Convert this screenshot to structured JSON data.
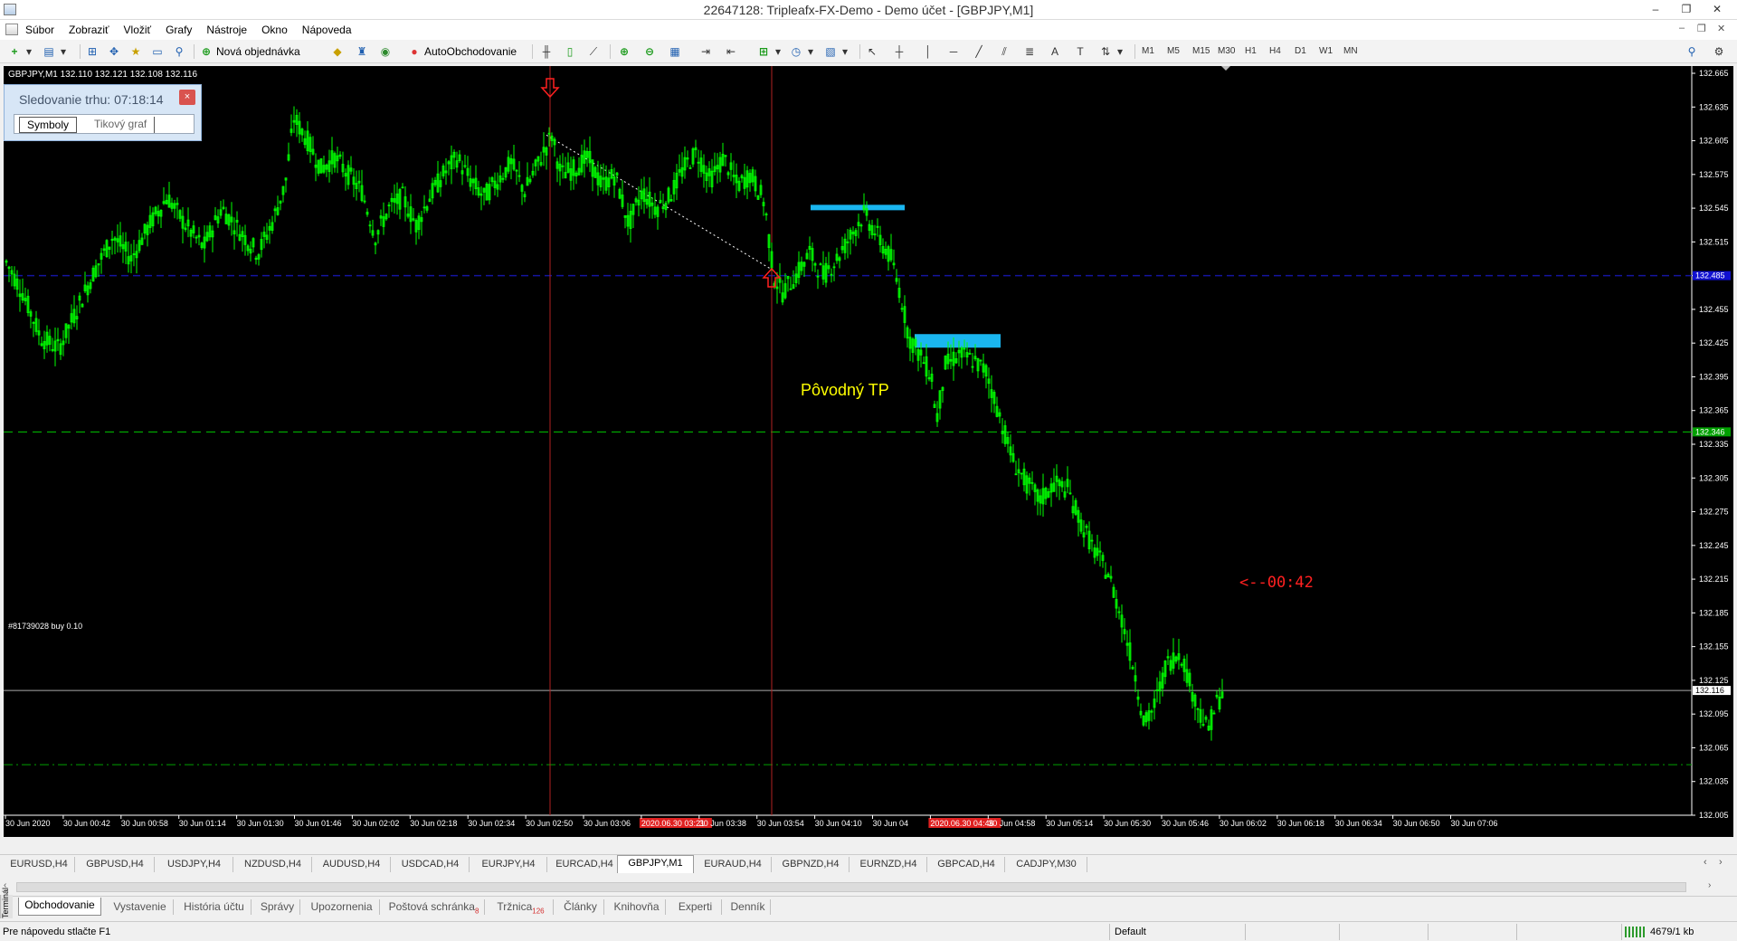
{
  "window": {
    "title": "22647128: Tripleafx-FX-Demo - Demo účet - [GBPJPY,M1]",
    "buttons": [
      "–",
      "❐",
      "✕"
    ]
  },
  "menu": {
    "items": [
      "Súbor",
      "Zobraziť",
      "Vložiť",
      "Grafy",
      "Nástroje",
      "Okno",
      "Nápoveda"
    ],
    "mdi_controls": [
      "–",
      "❐",
      "✕"
    ]
  },
  "toolbar": {
    "new_order_label": "Nová objednávka",
    "autotrading_label": "AutoObchodovanie",
    "timeframes": [
      "M1",
      "M5",
      "M15",
      "M30",
      "H1",
      "H4",
      "D1",
      "W1",
      "MN"
    ],
    "active_timeframe": "M1"
  },
  "chart": {
    "info_text": "GBPJPY,M1  132.110 132.121 132.108 132.116",
    "annotation_tp": "Pôvodný TP",
    "annotation_countdown": "<--00:42",
    "order_label": "#81739028 buy 0.10",
    "current_price_label": "132.116",
    "green_line_label": "132.346",
    "blue_line_label": "132.485",
    "red_date_label_1": "2020.06.30 03:21",
    "red_date_label_2": "2020.06.30 04:46",
    "colors": {
      "background": "#000000",
      "candles": "#00ff00",
      "vertical_lines": "#b22222",
      "tp_line": "#00c800",
      "blue_line": "#1414a0",
      "order_line": "#00a000",
      "rectangles": "#1ab6f0",
      "tp_text": "#ffff00",
      "countdown_text": "#ff2020"
    }
  },
  "chart_data": {
    "type": "candlestick",
    "symbol": "GBPJPY",
    "timeframe": "M1",
    "ohlc_current": {
      "open": 132.11,
      "high": 132.121,
      "low": 132.108,
      "close": 132.116
    },
    "y_ticks": [
      "132.665",
      "132.635",
      "132.605",
      "132.575",
      "132.545",
      "132.515",
      "132.485",
      "132.455",
      "132.425",
      "132.395",
      "132.365",
      "132.335",
      "132.305",
      "132.275",
      "132.245",
      "132.215",
      "132.185",
      "132.155",
      "132.125",
      "132.095",
      "132.065",
      "132.035",
      "132.005"
    ],
    "x_ticks": [
      "30 Jun 2020",
      "30 Jun 00:42",
      "30 Jun 00:58",
      "30 Jun 01:14",
      "30 Jun 01:30",
      "30 Jun 01:46",
      "30 Jun 02:02",
      "30 Jun 02:18",
      "30 Jun 02:34",
      "30 Jun 02:50",
      "30 Jun 03:06",
      "2020.06.30 03:21",
      "30 Jun 03:38",
      "30 Jun 03:54",
      "30 Jun 04:10",
      "30 Jun 04",
      "2020.06.30 04:46",
      "30 Jun 04:58",
      "30 Jun 05:14",
      "30 Jun 05:30",
      "30 Jun 05:46",
      "30 Jun 06:02",
      "30 Jun 06:18",
      "30 Jun 06:34",
      "30 Jun 06:50",
      "30 Jun 07:06"
    ],
    "ylim": [
      132.005,
      132.665
    ],
    "horizontal_lines": [
      {
        "price": 132.485,
        "style": "dashed",
        "color": "blue"
      },
      {
        "price": 132.346,
        "style": "dashed",
        "color": "green"
      },
      {
        "price": 132.116,
        "style": "solid",
        "color": "gray"
      },
      {
        "price": 132.05,
        "style": "dash-dot",
        "color": "green"
      }
    ],
    "price_path": [
      [
        0,
        132.5
      ],
      [
        20,
        132.47
      ],
      [
        40,
        132.43
      ],
      [
        60,
        132.42
      ],
      [
        80,
        132.455
      ],
      [
        100,
        132.49
      ],
      [
        120,
        132.52
      ],
      [
        140,
        132.5
      ],
      [
        160,
        132.53
      ],
      [
        180,
        132.555
      ],
      [
        200,
        132.53
      ],
      [
        220,
        132.51
      ],
      [
        240,
        132.545
      ],
      [
        260,
        132.525
      ],
      [
        280,
        132.505
      ],
      [
        295,
        132.53
      ],
      [
        310,
        132.565
      ],
      [
        320,
        132.625
      ],
      [
        335,
        132.605
      ],
      [
        350,
        132.58
      ],
      [
        365,
        132.59
      ],
      [
        380,
        132.575
      ],
      [
        395,
        132.56
      ],
      [
        410,
        132.52
      ],
      [
        425,
        132.545
      ],
      [
        440,
        132.555
      ],
      [
        455,
        132.53
      ],
      [
        470,
        132.555
      ],
      [
        485,
        132.575
      ],
      [
        500,
        132.59
      ],
      [
        515,
        132.57
      ],
      [
        530,
        132.555
      ],
      [
        545,
        132.57
      ],
      [
        560,
        132.585
      ],
      [
        575,
        132.56
      ],
      [
        590,
        132.585
      ],
      [
        605,
        132.61
      ],
      [
        615,
        132.575
      ],
      [
        630,
        132.58
      ],
      [
        645,
        132.59
      ],
      [
        660,
        132.565
      ],
      [
        675,
        132.575
      ],
      [
        690,
        132.53
      ],
      [
        705,
        132.56
      ],
      [
        720,
        132.545
      ],
      [
        735,
        132.555
      ],
      [
        750,
        132.58
      ],
      [
        765,
        132.595
      ],
      [
        780,
        132.57
      ],
      [
        795,
        132.59
      ],
      [
        810,
        132.565
      ],
      [
        825,
        132.575
      ],
      [
        840,
        132.55
      ],
      [
        850,
        132.485
      ],
      [
        860,
        132.47
      ],
      [
        875,
        132.485
      ],
      [
        890,
        132.505
      ],
      [
        905,
        132.485
      ],
      [
        920,
        132.5
      ],
      [
        935,
        132.52
      ],
      [
        950,
        132.54
      ],
      [
        965,
        132.52
      ],
      [
        980,
        132.5
      ],
      [
        990,
        132.47
      ],
      [
        1000,
        132.43
      ],
      [
        1015,
        132.41
      ],
      [
        1025,
        132.395
      ],
      [
        1030,
        132.355
      ],
      [
        1040,
        132.405
      ],
      [
        1055,
        132.415
      ],
      [
        1070,
        132.41
      ],
      [
        1085,
        132.4
      ],
      [
        1100,
        132.36
      ],
      [
        1115,
        132.32
      ],
      [
        1130,
        132.3
      ],
      [
        1145,
        132.285
      ],
      [
        1160,
        132.3
      ],
      [
        1175,
        132.295
      ],
      [
        1190,
        132.265
      ],
      [
        1205,
        132.24
      ],
      [
        1220,
        132.22
      ],
      [
        1235,
        132.18
      ],
      [
        1250,
        132.13
      ],
      [
        1260,
        132.085
      ],
      [
        1270,
        132.1
      ],
      [
        1285,
        132.14
      ],
      [
        1300,
        132.15
      ],
      [
        1315,
        132.11
      ],
      [
        1330,
        132.08
      ],
      [
        1340,
        132.105
      ],
      [
        1350,
        132.116
      ]
    ]
  },
  "market_watch": {
    "title": "Sledovanie trhu: 07:18:14",
    "tabs": [
      "Symboly",
      "Tikový graf"
    ]
  },
  "chart_tabs": [
    "EURUSD,H4",
    "GBPUSD,H4",
    "USDJPY,H4",
    "NZDUSD,H4",
    "AUDUSD,H4",
    "USDCAD,H4",
    "EURJPY,H4",
    "EURCAD,H4",
    "GBPJPY,M1",
    "EURAUD,H4",
    "GBPNZD,H4",
    "EURNZD,H4",
    "GBPCAD,H4",
    "CADJPY,M30"
  ],
  "active_chart_tab": "GBPJPY,M1",
  "terminal": {
    "side_label": "Terminál",
    "tabs": [
      "Obchodovanie",
      "Vystavenie",
      "História účtu",
      "Správy",
      "Upozornenia",
      "Poštová schránka",
      "Tržnica",
      "Články",
      "Knihovňa",
      "Experti",
      "Denník"
    ],
    "mail_badge": "8",
    "market_badge": "126"
  },
  "status": {
    "help_text": "Pre nápovedu stlačte F1",
    "profile": "Default",
    "traffic": "4679/1 kb"
  }
}
